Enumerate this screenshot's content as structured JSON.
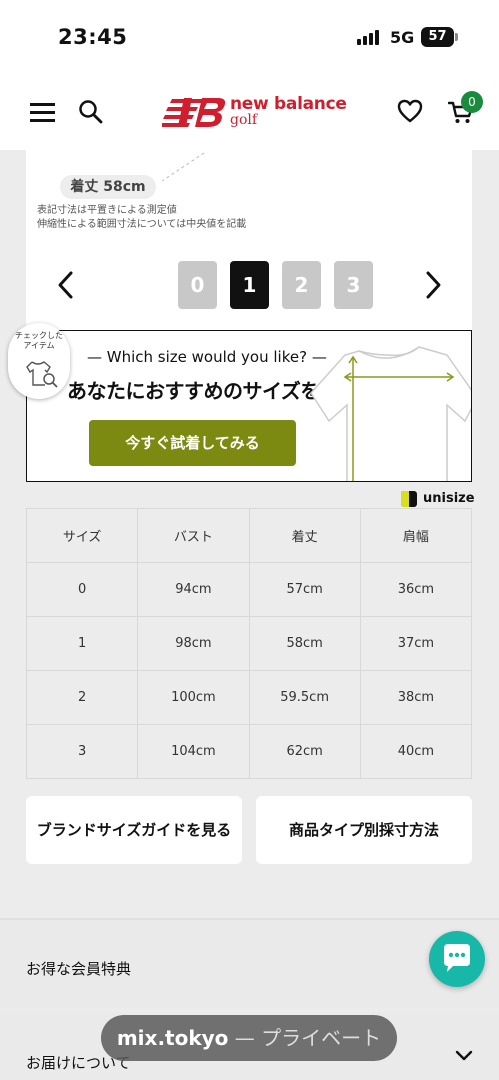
{
  "status_bar": {
    "time": "23:45",
    "network": "5G",
    "battery": "57"
  },
  "header": {
    "brand": "new balance",
    "brand_sub": "golf",
    "cart_count": "0",
    "icons": [
      "menu-icon",
      "search-icon",
      "heart-icon",
      "cart-icon"
    ]
  },
  "product_image": {
    "measure_label": "着丈 58cm",
    "note1": "表記寸法は平置きによる測定値",
    "note2": "伸縮性による範囲寸法については中央値を記載"
  },
  "pagination": {
    "pages": [
      "0",
      "1",
      "2",
      "3"
    ],
    "active": "1"
  },
  "banner": {
    "question": "— Which size would you like? —",
    "title": "あなたにおすすめのサイズを知る",
    "cta": "今すぐ試着してみる"
  },
  "checked_items": {
    "label_line1": "チェックした",
    "label_line2": "アイテム"
  },
  "unisize": {
    "label": "unisize"
  },
  "size_table": {
    "headers": [
      "サイズ",
      "バスト",
      "着丈",
      "肩幅"
    ],
    "rows": [
      [
        "0",
        "94cm",
        "57cm",
        "36cm"
      ],
      [
        "1",
        "98cm",
        "58cm",
        "37cm"
      ],
      [
        "2",
        "100cm",
        "59.5cm",
        "38cm"
      ],
      [
        "3",
        "104cm",
        "62cm",
        "40cm"
      ]
    ]
  },
  "buttons": {
    "brand_size_guide": "ブランドサイズガイドを見る",
    "measure_method": "商品タイプ別採寸方法"
  },
  "accordion": {
    "member_benefits": "お得な会員特典",
    "delivery": "お届けについて"
  },
  "browser": {
    "domain": "mix.tokyo",
    "mode": "— プライベート"
  },
  "colors": {
    "brand_red": "#cf1f2e",
    "cta_olive": "#7d8a12",
    "chat_teal": "#18b8a8",
    "badge_green": "#1a8a3d"
  }
}
